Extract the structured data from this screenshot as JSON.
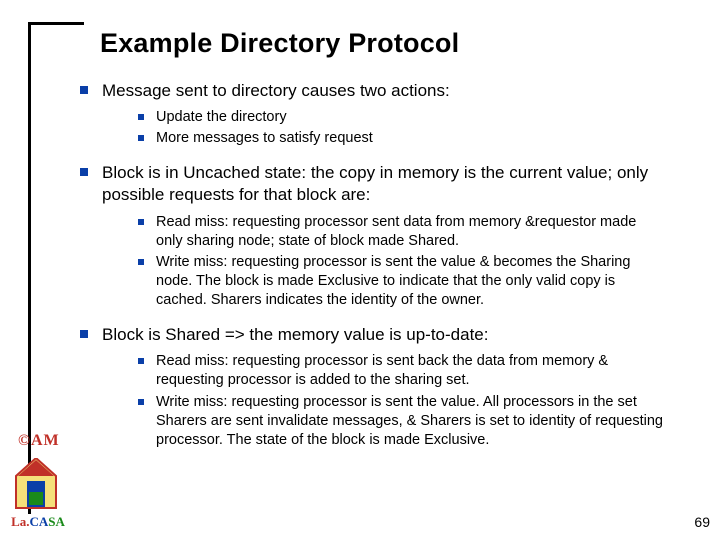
{
  "title": "Example Directory Protocol",
  "bullets": {
    "b1": "Message sent to directory causes two actions:",
    "b1_1": "Update the directory",
    "b1_2": "More messages to satisfy request",
    "b2": "Block is in Uncached state: the copy in memory is the current value; only possible requests for that block are:",
    "b2_1": "Read miss: requesting processor sent data from memory &requestor made only sharing node; state of block made Shared.",
    "b2_2": "Write miss: requesting processor is sent the value & becomes the Sharing node. The block is made Exclusive to indicate that the only valid copy is cached. Sharers indicates the identity of the owner.",
    "b3": "Block is Shared => the memory value is up-to-date:",
    "b3_1": "Read miss: requesting processor is sent back the data from memory & requesting processor is added to the sharing set.",
    "b3_2": "Write miss: requesting processor is sent the value. All processors in the set Sharers are sent invalidate messages, & Sharers is set to identity of requesting processor. The state of the block is made Exclusive."
  },
  "footer": {
    "am": "©AM",
    "la": "La.",
    "ca": "CA",
    "sa": "SA",
    "page": "69"
  }
}
